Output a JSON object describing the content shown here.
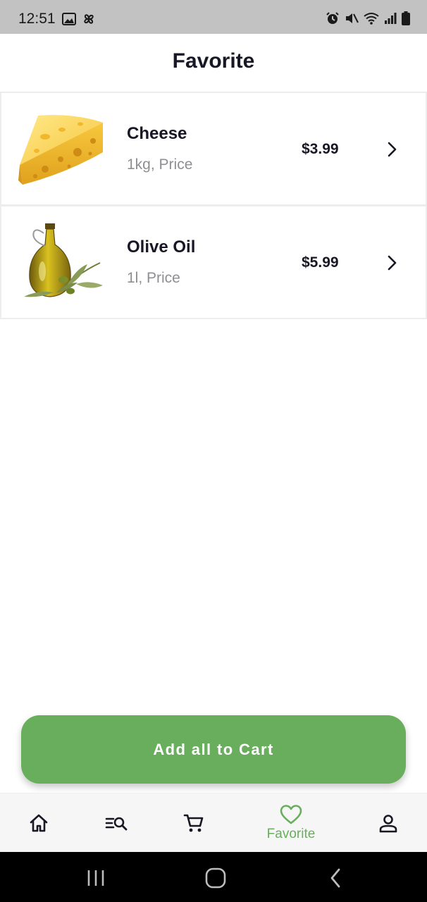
{
  "status_bar": {
    "time": "12:51",
    "left_icons": [
      "image-icon",
      "pinwheel-icon"
    ],
    "right_icons": [
      "alarm-icon",
      "mute-icon",
      "wifi-icon",
      "signal-icon",
      "battery-icon"
    ]
  },
  "header": {
    "title": "Favorite"
  },
  "favorites": [
    {
      "name": "Cheese",
      "detail": "1kg, Price",
      "price": "$3.99",
      "image": "cheese-image"
    },
    {
      "name": "Olive Oil",
      "detail": "1l, Price",
      "price": "$5.99",
      "image": "olive-oil-image"
    }
  ],
  "cta": {
    "label": "Add all to Cart"
  },
  "bottom_nav": {
    "items": [
      {
        "icon": "home-icon",
        "label": ""
      },
      {
        "icon": "search-list-icon",
        "label": ""
      },
      {
        "icon": "cart-icon",
        "label": ""
      },
      {
        "icon": "heart-icon",
        "label": "Favorite",
        "active": true
      },
      {
        "icon": "account-icon",
        "label": ""
      }
    ]
  },
  "android_nav": [
    "recent-apps-icon",
    "home-circle-icon",
    "back-icon"
  ],
  "colors": {
    "accent": "#69ae5d",
    "text_primary": "#181725",
    "text_secondary": "#8e8e93",
    "status_bar": "#c2c2c2",
    "nav_background": "#f6f6f6"
  }
}
